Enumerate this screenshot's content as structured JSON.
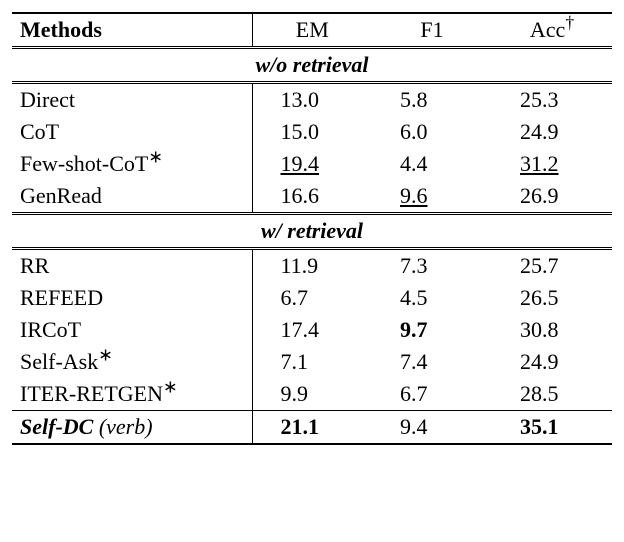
{
  "headers": {
    "methods": "Methods",
    "em": "EM",
    "f1": "F1",
    "acc": "Acc",
    "dagger": "†"
  },
  "sections": {
    "wo": "w/o retrieval",
    "w": "w/ retrieval"
  },
  "rows_wo": [
    {
      "method": "Direct",
      "star": "",
      "em": "13.0",
      "f1": "5.8",
      "acc": "25.3",
      "em_ul": false,
      "f1_ul": false,
      "acc_ul": false,
      "em_b": false,
      "f1_b": false,
      "acc_b": false
    },
    {
      "method": "CoT",
      "star": "",
      "em": "15.0",
      "f1": "6.0",
      "acc": "24.9",
      "em_ul": false,
      "f1_ul": false,
      "acc_ul": false,
      "em_b": false,
      "f1_b": false,
      "acc_b": false
    },
    {
      "method": "Few-shot-CoT",
      "star": "∗",
      "em": "19.4",
      "f1": "4.4",
      "acc": "31.2",
      "em_ul": true,
      "f1_ul": false,
      "acc_ul": true,
      "em_b": false,
      "f1_b": false,
      "acc_b": false
    },
    {
      "method": "GenRead",
      "star": "",
      "em": "16.6",
      "f1": "9.6",
      "acc": "26.9",
      "em_ul": false,
      "f1_ul": true,
      "acc_ul": false,
      "em_b": false,
      "f1_b": false,
      "acc_b": false
    }
  ],
  "rows_w": [
    {
      "method": "RR",
      "star": "",
      "em": "11.9",
      "f1": "7.3",
      "acc": "25.7",
      "em_ul": false,
      "f1_ul": false,
      "acc_ul": false,
      "em_b": false,
      "f1_b": false,
      "acc_b": false
    },
    {
      "method": "REFEED",
      "star": "",
      "em": "6.7",
      "f1": "4.5",
      "acc": "26.5",
      "em_ul": false,
      "f1_ul": false,
      "acc_ul": false,
      "em_b": false,
      "f1_b": false,
      "acc_b": false
    },
    {
      "method": "IRCoT",
      "star": "",
      "em": "17.4",
      "f1": "9.7",
      "acc": "30.8",
      "em_ul": false,
      "f1_ul": false,
      "acc_ul": false,
      "em_b": false,
      "f1_b": true,
      "acc_b": false
    },
    {
      "method": "Self-Ask",
      "star": "∗",
      "em": "7.1",
      "f1": "7.4",
      "acc": "24.9",
      "em_ul": false,
      "f1_ul": false,
      "acc_ul": false,
      "em_b": false,
      "f1_b": false,
      "acc_b": false
    },
    {
      "method": "ITER-RETGEN",
      "star": "∗",
      "em": "9.9",
      "f1": "6.7",
      "acc": "28.5",
      "em_ul": false,
      "f1_ul": false,
      "acc_ul": false,
      "em_b": false,
      "f1_b": false,
      "acc_b": false
    }
  ],
  "final": {
    "method_main": "Self-DC",
    "method_note": "(verb)",
    "em": "21.1",
    "f1": "9.4",
    "acc": "35.1"
  }
}
